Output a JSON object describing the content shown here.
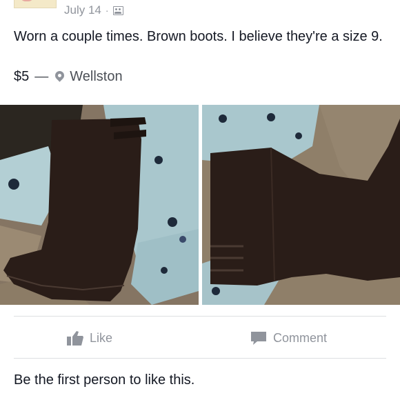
{
  "post": {
    "date": "July 14",
    "separator": "·",
    "audience_icon": "public-friends-icon",
    "text": "Worn a couple times. Brown boots. I believe they're a size 9.",
    "price": "$5",
    "price_separator": "—",
    "location_icon": "map-pin-icon",
    "location": "Wellston",
    "photos": [
      {
        "name": "boot-photo-left",
        "subject": "brown-boot"
      },
      {
        "name": "boot-photo-right",
        "subject": "brown-boot"
      }
    ]
  },
  "actions": {
    "like_label": "Like",
    "comment_label": "Comment"
  },
  "footer": {
    "likes_summary": "Be the first person to like this."
  },
  "colors": {
    "text": "#141823",
    "muted": "#90949c",
    "divider": "#dddfe2",
    "boot": "#2a1d18"
  }
}
